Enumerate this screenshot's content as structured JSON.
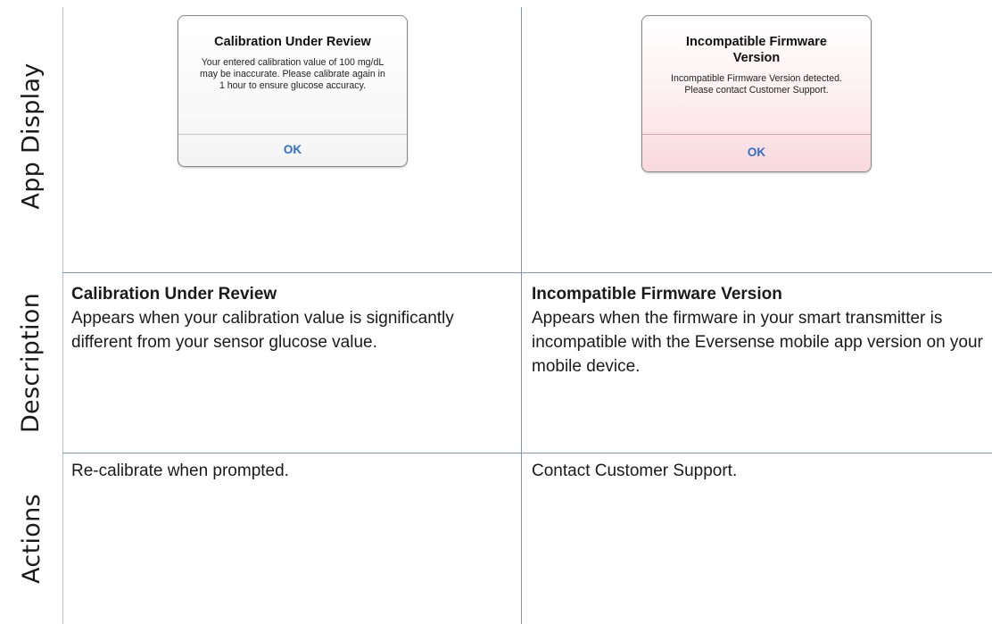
{
  "rows": {
    "app_display": "App Display",
    "description": "Description",
    "actions": "Actions"
  },
  "left": {
    "alert": {
      "title": "Calibration Under Review",
      "message": "Your entered calibration value of 100 mg/dL may be inaccurate. Please calibrate again in 1 hour to ensure glucose accuracy.",
      "button": "OK"
    },
    "description_title": "Calibration Under Review",
    "description_text": "Appears when your calibration value is significantly different from your sensor glucose value.",
    "action": "Re-calibrate when prompted."
  },
  "right": {
    "alert": {
      "title": "Incompatible Firmware Version",
      "message": "Incompatible Firmware Version detected. Please contact Customer Support.",
      "button": "OK"
    },
    "description_title": "Incompatible Firmware Version",
    "description_text": "Appears when the firmware in your smart transmitter is incompatible with the Eversense mobile app version on your mobile device.",
    "action": "Contact Customer Support."
  },
  "colors": {
    "grid_line": "#7f93b5",
    "ok_button": "#2f6fd0",
    "alert_tint_error": "#f9d9dc"
  }
}
